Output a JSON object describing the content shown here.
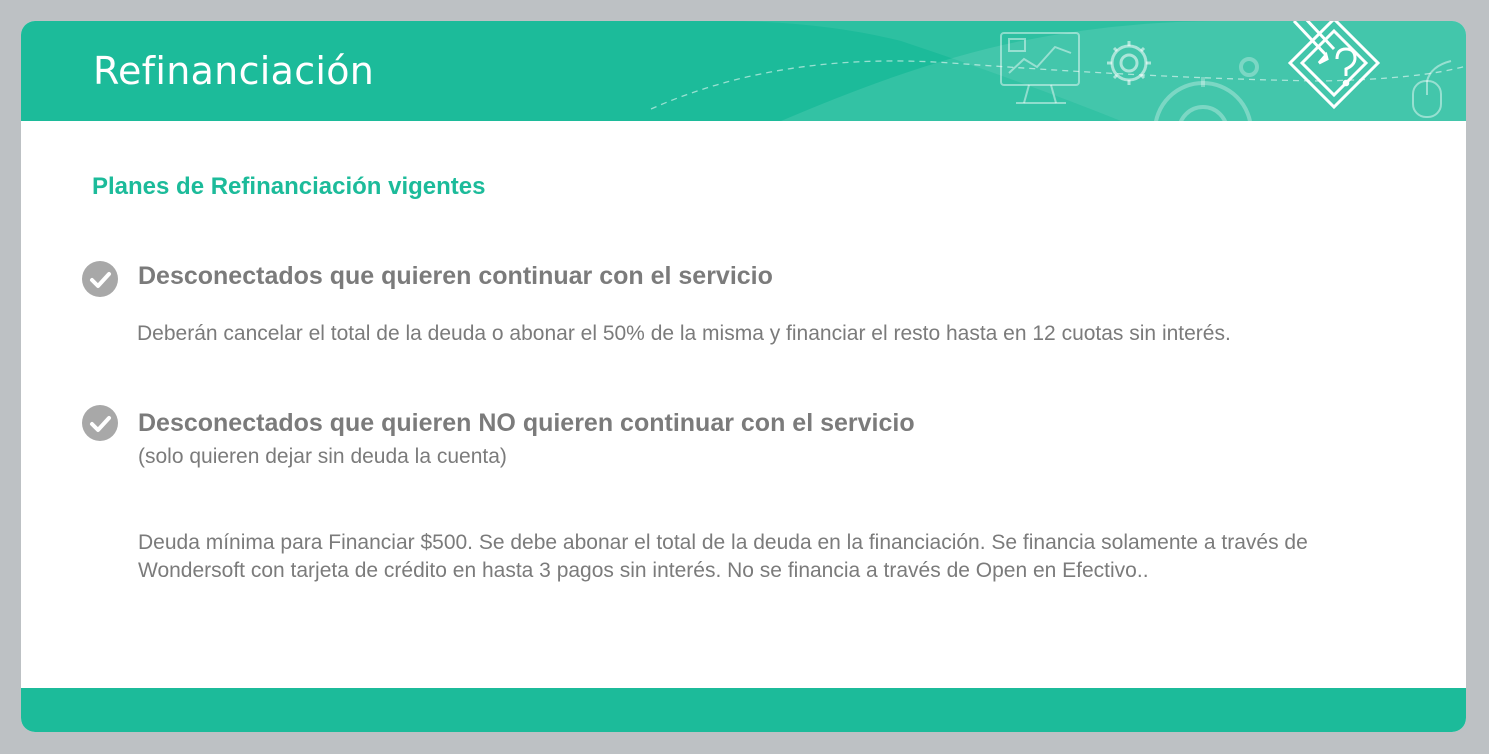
{
  "header": {
    "title": "Refinanciación",
    "decor_icons": [
      "monitor-chart-icon",
      "gear-icon",
      "gear-large-icon",
      "pencil-question-icon",
      "mouse-icon"
    ]
  },
  "section": {
    "title": "Planes de Refinanciación vigentes"
  },
  "items": [
    {
      "icon": "check-circle-icon",
      "title": "Desconectados que quieren continuar con el servicio",
      "description": "Deberán cancelar el total de la deuda o abonar el 50% de la misma y financiar el resto hasta en 12 cuotas sin interés."
    },
    {
      "icon": "check-circle-icon",
      "title": "Desconectados que quieren NO quieren continuar con el servicio",
      "subtitle": "(solo quieren dejar sin deuda la cuenta)",
      "description": "Deuda mínima para Financiar $500. Se debe abonar el total de la deuda en la financiación. Se financia solamente a través de Wondersoft con tarjeta de crédito en hasta 3 pagos sin interés. No se financia a través de Open en Efectivo.."
    }
  ],
  "colors": {
    "accent": "#1cbb9a",
    "background": "#bdc1c4",
    "text": "#7b7b7b",
    "check": "#a8a8a8"
  }
}
